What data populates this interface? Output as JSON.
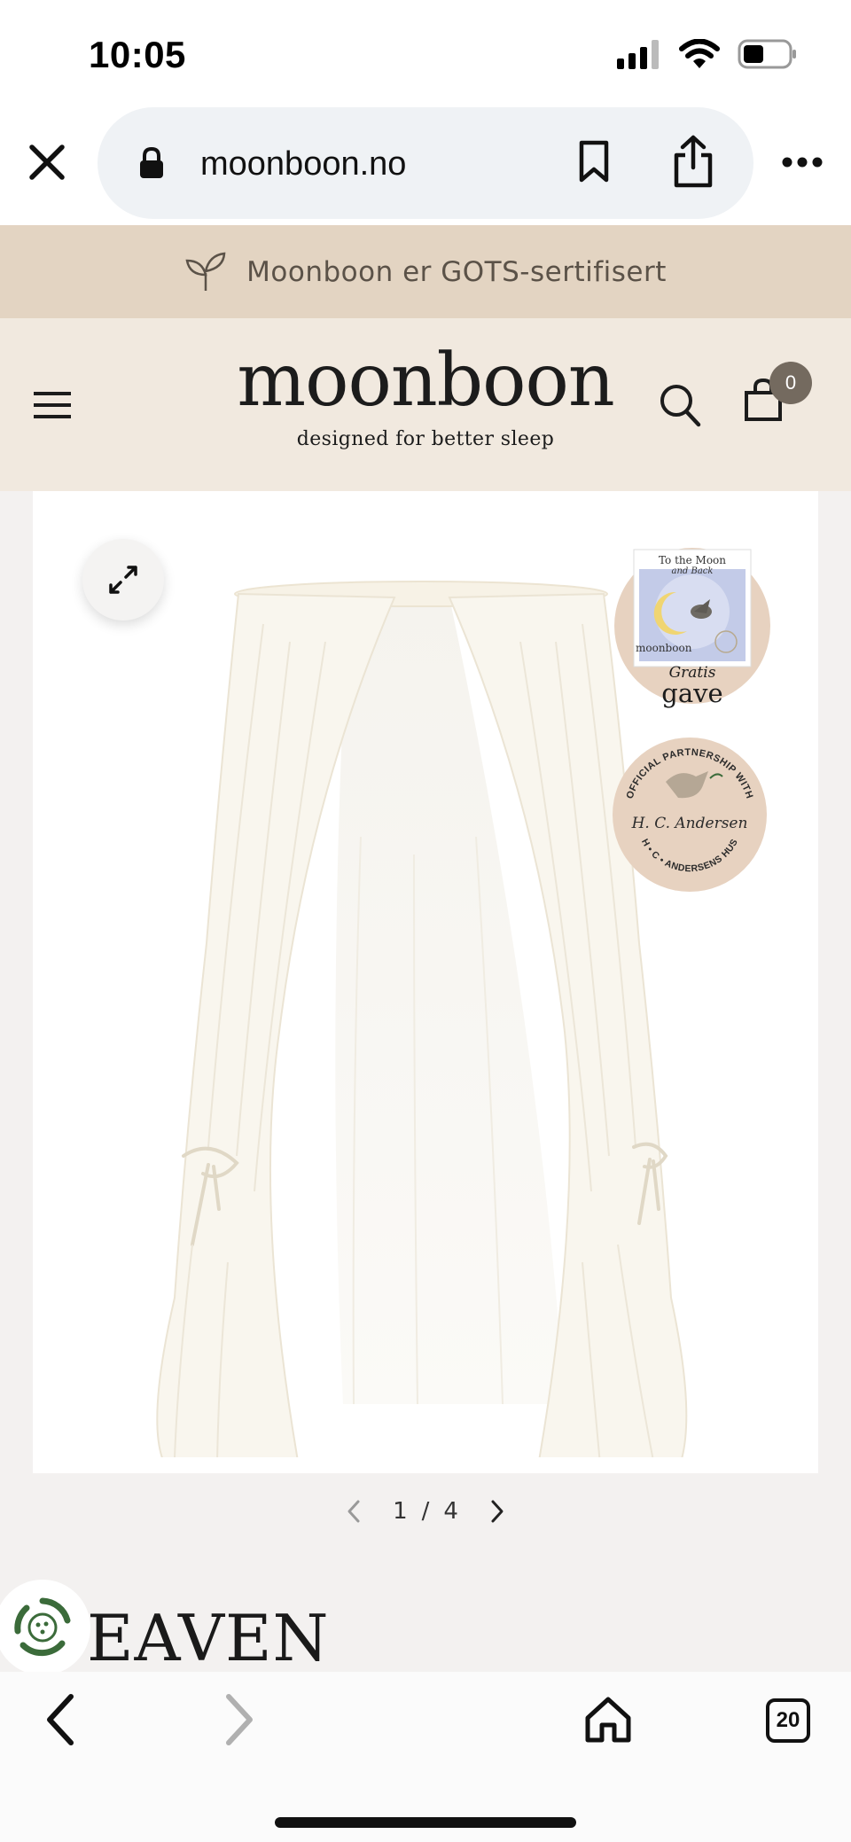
{
  "status_bar": {
    "time": "10:05"
  },
  "browser": {
    "url": "moonboon.no",
    "tab_count": "20"
  },
  "banner": {
    "text": "Moonboon er GOTS-sertifisert"
  },
  "header": {
    "logo": "moonboon",
    "tagline": "designed for better sleep",
    "cart_count": "0"
  },
  "gallery": {
    "current": "1",
    "separator": "/",
    "total": "4",
    "gift_badge": {
      "book_title": "To the Moon",
      "book_subtitle": "and Back",
      "book_brand": "moonboon",
      "label_line1": "Gratis",
      "label_line2": "gave"
    },
    "partner_badge": {
      "ring_text": "OFFICIAL PARTNERSHIP WITH",
      "signature": "H. C. Andersen",
      "bottom_text": "H • C • ANDERSENS HUS"
    }
  },
  "product": {
    "title_peek": "EAVEN"
  },
  "colors": {
    "banner_bg": "#e3d4c2",
    "header_bg": "#f1e9df",
    "badge_bg": "#e7d2c0",
    "cart_badge": "#746a5f",
    "eco_green": "#3b6b3a"
  },
  "icons": {
    "close": "close-icon",
    "lock": "lock-icon",
    "bookmark": "bookmark-icon",
    "share": "share-icon",
    "more": "more-icon",
    "sprout": "sprout-icon",
    "menu": "menu-icon",
    "search": "search-icon",
    "cart": "cart-icon",
    "expand": "expand-icon",
    "back": "chevron-left-icon",
    "forward": "chevron-right-icon",
    "home": "home-icon"
  }
}
